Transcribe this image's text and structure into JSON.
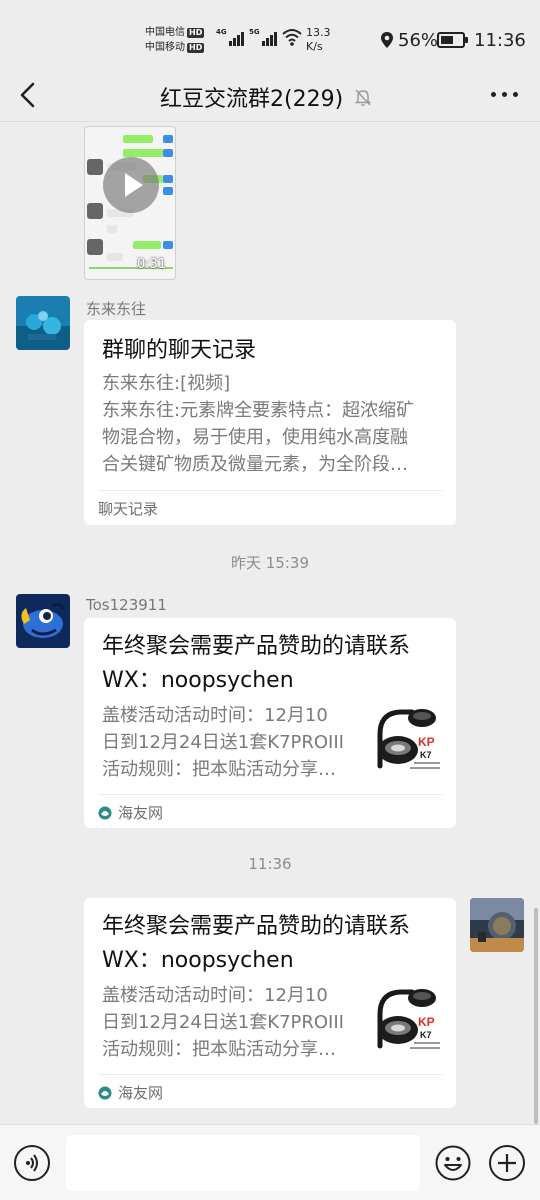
{
  "status_bar": {
    "carrier1": "中国电信",
    "carrier2": "中国移动",
    "hd": "HD",
    "net1": "4G",
    "net2": "5G",
    "speed_value": "13.3",
    "speed_unit": "K/s",
    "battery": "56%",
    "time": "11:36"
  },
  "header": {
    "title": "红豆交流群2(229)"
  },
  "messages": [
    {
      "type": "video",
      "duration": "0:31"
    },
    {
      "type": "chat-record",
      "sender": "东来东往",
      "title": "群聊的聊天记录",
      "line1": "东来东往:[视频]",
      "line2": "东来东往:元素牌全要素特点：超浓缩矿",
      "line3": "物混合物，易于使用，使用纯水高度融",
      "line4": "合关键矿物质及微量元素，为全阶段…",
      "footer": "聊天记录"
    },
    {
      "type": "timestamp",
      "text": "昨天 15:39"
    },
    {
      "type": "link",
      "sender": "Tos123911",
      "title1": "年终聚会需要产品赞助的请联系",
      "title2": "WX：noopsychen",
      "desc1": "盖楼活动活动时间：12月10",
      "desc2": "日到12月24日送1套K7PROIII",
      "desc3": "活动规则：把本贴活动分享…",
      "source": "海友网"
    },
    {
      "type": "timestamp",
      "text": "11:36"
    },
    {
      "type": "link",
      "sender": "",
      "title1": "年终聚会需要产品赞助的请联系",
      "title2": "WX：noopsychen",
      "desc1": "盖楼活动活动时间：12月10",
      "desc2": "日到12月24日送1套K7PROIII",
      "desc3": "活动规则：把本贴活动分享…",
      "source": "海友网"
    }
  ],
  "product_logo": "KP",
  "product_model": "K7",
  "input": {
    "placeholder": ""
  },
  "colors": {
    "background": "#ededed",
    "bubble": "#ffffff",
    "accent_red": "#d8342b"
  },
  "icons": [
    "back-icon",
    "mute-icon",
    "more-icon",
    "play-icon",
    "voice-icon",
    "emoji-icon",
    "plus-icon",
    "haiyou-logo-icon"
  ]
}
